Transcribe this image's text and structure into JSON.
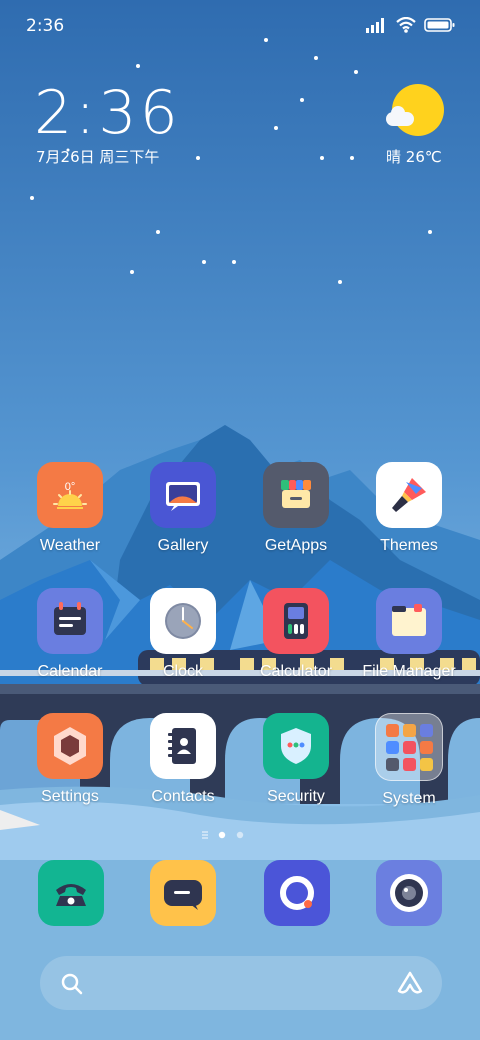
{
  "status_bar": {
    "time": "2:36",
    "icons": [
      "signal-icon",
      "wifi-icon",
      "battery-icon"
    ]
  },
  "lock_clock": {
    "time": "2:36",
    "date": "7月26日 周三下午"
  },
  "weather": {
    "condition": "晴",
    "temperature": "26℃",
    "icon": "sunny-cloud-icon"
  },
  "apps": [
    {
      "label": "Weather"
    },
    {
      "label": "Gallery"
    },
    {
      "label": "GetApps"
    },
    {
      "label": "Themes"
    },
    {
      "label": "Calendar"
    },
    {
      "label": "Clock"
    },
    {
      "label": "Calculator"
    },
    {
      "label": "File Manager"
    },
    {
      "label": "Settings"
    },
    {
      "label": "Contacts"
    },
    {
      "label": "Security"
    },
    {
      "label": "System"
    }
  ],
  "weather_icon_text": "0°",
  "dock": [
    {
      "name": "phone-app",
      "color": "#12b592"
    },
    {
      "name": "messages-app",
      "color": "#ffc24a"
    },
    {
      "name": "browser-app",
      "color": "#4b55d8"
    },
    {
      "name": "camera-app",
      "color": "#6b7fe0"
    }
  ],
  "page_indicator": {
    "pages": 2,
    "active": 1
  },
  "search": {
    "icon": "search-icon",
    "assistant_icon": "assistant-icon"
  },
  "colors": {
    "sky_top": "#2f6fb2",
    "sky_bottom": "#7ab7e6",
    "mountain": "#2a7cc4"
  }
}
